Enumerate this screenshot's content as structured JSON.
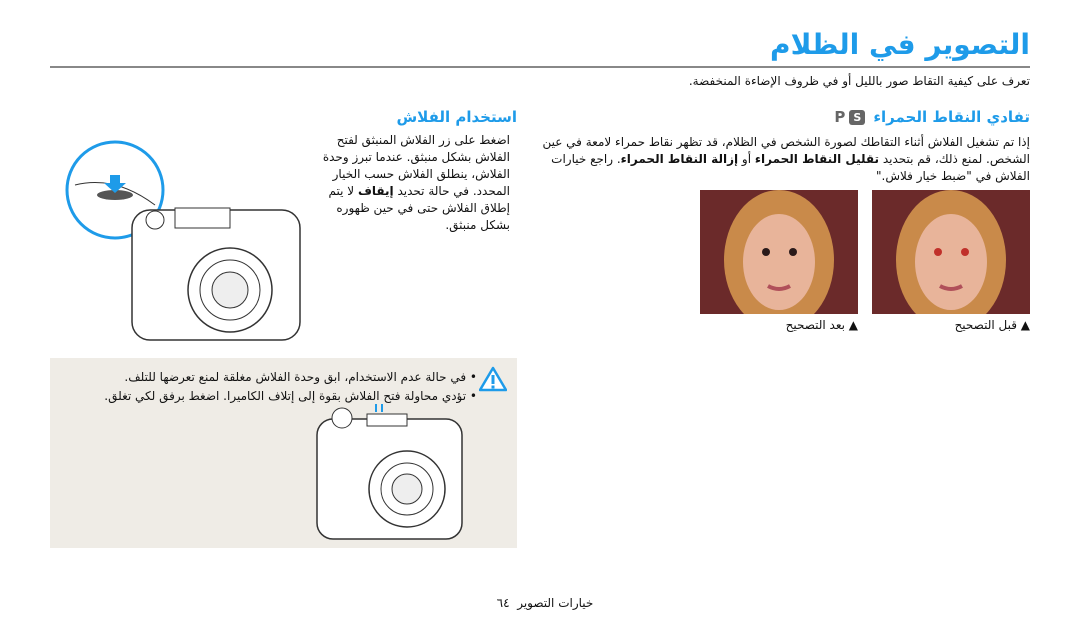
{
  "page": {
    "title": "التصوير في الظلام",
    "intro": "تعرف على كيفية التقاط صور بالليل أو في ظروف الإضاءة المنخفضة."
  },
  "red_eye": {
    "heading": "تفادي النقاط الحمراء",
    "modes": [
      "S",
      "P"
    ],
    "para_1": "إذا تم تشغيل الفلاش أثناء التقاطك لصورة الشخص في الظلام، قد تظهر نقاط حمراء لامعة في عين الشخص. لمنع ذلك، قم بتحديد ",
    "bold_1": "تقليل النقاط الحمراء",
    "para_2": " أو ",
    "bold_2": "إزالة النقاط الحمراء",
    "para_3": ". راجع خيارات الفلاش في \"ضبط خيار فلاش.\"",
    "caption_before": "▲ قبل التصحيح",
    "caption_after": "▲ بعد التصحيح"
  },
  "flash": {
    "heading": "استخدام الفلاش",
    "para_1": "اضغط على زر الفلاش المنبثق لفتح الفلاش بشكل منبثق. عندما تبرز وحدة الفلاش، ينطلق الفلاش حسب الخيار المحدد. في حالة تحديد ",
    "bold": "إيقاف",
    "para_2": " لا يتم إطلاق الفلاش حتى في حين ظهوره بشكل منبثق."
  },
  "warning": {
    "icon": "warning-triangle-icon",
    "items": [
      "في حالة عدم الاستخدام، ابق وحدة الفلاش مغلقة لمنع تعرضها للتلف.",
      "تؤدي محاولة فتح الفلاش بقوة إلى إتلاف الكاميرا. اضغط برفق لكي تغلق."
    ]
  },
  "footer": {
    "section": "خيارات التصوير",
    "page_number": "٦٤"
  },
  "colors": {
    "accent": "#1e9be9",
    "warning_bg": "#efece6"
  }
}
